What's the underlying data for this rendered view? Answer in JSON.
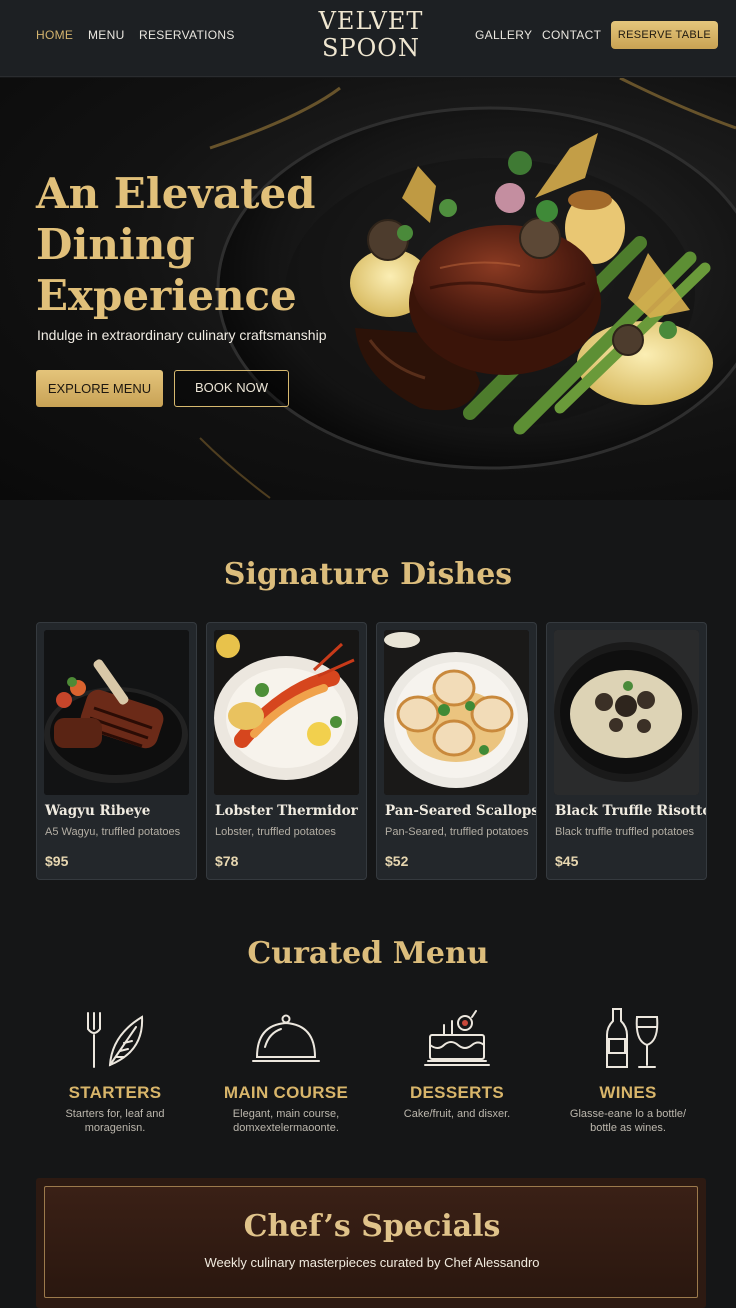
{
  "nav": {
    "links_left": [
      "HOME",
      "MENU",
      "RESERVATIONS"
    ],
    "active": "HOME",
    "logo_line1": "VELVET",
    "logo_line2": "SPOON",
    "links_right": [
      "GALLERY",
      "CONTACT"
    ],
    "reserve_label": "RESERVE TABLE"
  },
  "hero": {
    "title_lines": [
      "An Elevated",
      "Dining",
      "Experience"
    ],
    "subtitle": "Indulge in extraordinary culinary craftsmanship",
    "explore_label": "EXPLORE MENU",
    "book_label": "BOOK NOW"
  },
  "signature": {
    "title": "Signature Dishes",
    "dishes": [
      {
        "name": "Wagyu Ribeye",
        "desc": "A5 Wagyu, truffled potatoes",
        "price": "$95",
        "image": "steak-plate"
      },
      {
        "name": "Lobster Thermidor",
        "desc": "Lobster, truffled potatoes",
        "price": "$78",
        "image": "lobster-plate"
      },
      {
        "name": "Pan-Seared Scallops",
        "desc": "Pan-Seared, truffled potatoes",
        "price": "$52",
        "image": "scallops-plate"
      },
      {
        "name": "Black Truffle Risotto",
        "desc": "Black truffle truffled potatoes",
        "price": "$45",
        "image": "risotto-plate"
      }
    ]
  },
  "curated": {
    "title": "Curated Menu",
    "categories": [
      {
        "name": "STARTERS",
        "desc": "Starters for, leaf and moragenisn.",
        "icon": "fork-leaf-icon"
      },
      {
        "name": "MAIN COURSE",
        "desc": "Elegant, main course, domxextelermaoonte.",
        "icon": "cloche-icon"
      },
      {
        "name": "DESSERTS",
        "desc": "Cake/fruit, and disxer.",
        "icon": "cake-icon"
      },
      {
        "name": "WINES",
        "desc": "Glasse-eane lo a bottle/ bottle as wines.",
        "icon": "wine-icon"
      }
    ]
  },
  "chef": {
    "title": "Chef’s Specials",
    "subtitle": "Weekly culinary masterpieces curated by Chef Alessandro"
  },
  "colors": {
    "gold": "#d8b56a",
    "background": "#151617",
    "card": "#23272b",
    "burgundy": "#2d1a12"
  }
}
